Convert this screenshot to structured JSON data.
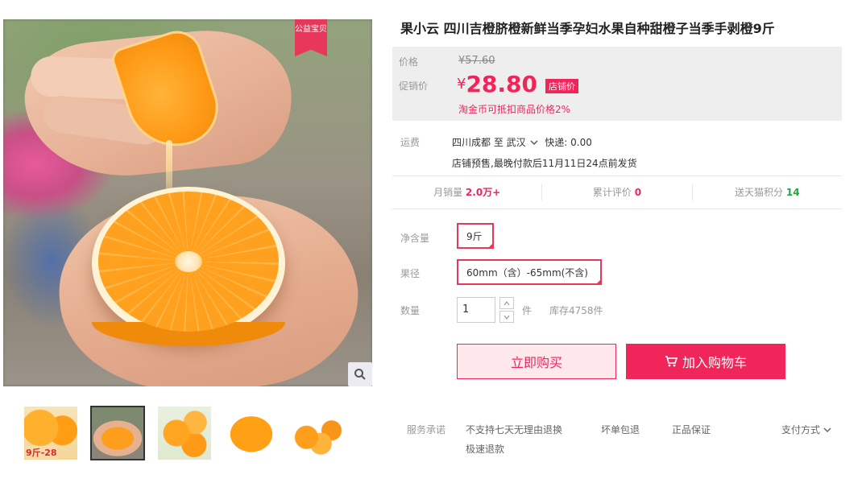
{
  "product": {
    "title": "果小云 四川吉橙脐橙新鲜当季孕妇水果自种甜橙子当季手剥橙9斤",
    "charity_badge": "公益宝贝",
    "zoom_icon": "search-icon"
  },
  "price": {
    "original_label": "价格",
    "original_value": "¥57.60",
    "promo_label": "促销价",
    "currency": "¥",
    "promo_value": "28.80",
    "promo_tag": "店铺价",
    "points_note": "淘金币可抵扣商品价格2%"
  },
  "shipping": {
    "label": "运费",
    "route": "四川成都 至 武汉",
    "express": "快递: 0.00",
    "note": "店铺预售,最晚付款后11月11日24点前发货"
  },
  "stats": {
    "monthly_sales_label": "月销量",
    "monthly_sales_value": "2.0万+",
    "reviews_label": "累计评价",
    "reviews_value": "0",
    "points_label": "送天猫积分",
    "points_value": "14"
  },
  "options": {
    "net_label": "净含量",
    "net_value": "9斤",
    "size_label": "果径",
    "size_value": "60mm（含）-65mm(不含)",
    "qty_label": "数量",
    "qty_value": "1",
    "qty_unit": "件",
    "stock": "库存4758件"
  },
  "actions": {
    "buy_now": "立即购买",
    "add_to_cart": "加入购物车"
  },
  "thumbnails": [
    {
      "name": "thumb-1",
      "tag": "9斤-28"
    },
    {
      "name": "thumb-2"
    },
    {
      "name": "thumb-3"
    },
    {
      "name": "thumb-4"
    },
    {
      "name": "thumb-5"
    }
  ],
  "service": {
    "label": "服务承诺",
    "item1": "不支持七天无理由退换",
    "item1_sub": "极速退款",
    "item2": "坏单包退",
    "item3": "正品保证",
    "payment": "支付方式"
  },
  "colors": {
    "accent": "#f0265a",
    "green": "#27a43f"
  }
}
